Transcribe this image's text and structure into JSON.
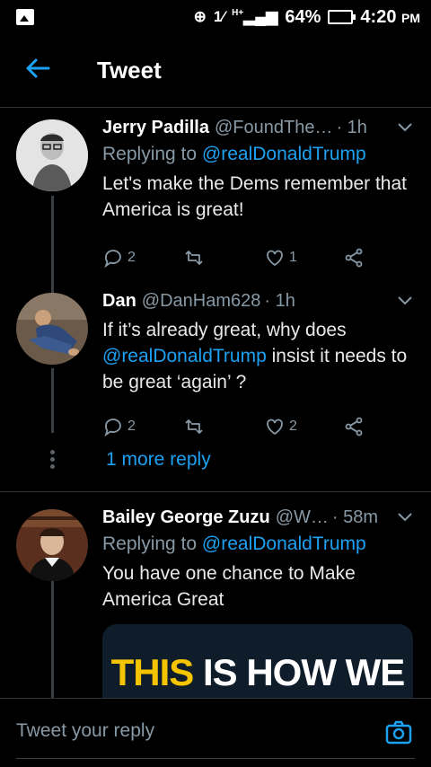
{
  "status_bar": {
    "signal_label": "1⁄",
    "network_label": "H+",
    "battery_text": "64%",
    "battery_level": 0.64,
    "time": "4:20",
    "ampm": "PM"
  },
  "header": {
    "title": "Tweet"
  },
  "tweets": [
    {
      "name": "Jerry Padilla",
      "handle": "@FoundThe…",
      "time": "· 1h",
      "replying_prefix": "Replying to",
      "replying_handle": "@realDonaldTrump",
      "text": "Let's make the Dems remember that America is great!",
      "replies": "2",
      "likes": "1"
    },
    {
      "name": "Dan",
      "handle": "@DanHam628",
      "time": "· 1h",
      "mention": "@realDonaldTrump",
      "text_after_mention": " insist it needs to be great ‘again’ ?",
      "text_before_mention": "If it’s already great, why does",
      "replies": "2",
      "likes": "2"
    },
    {
      "name": "Bailey George Zuzu",
      "handle": "@W…",
      "time": "· 58m",
      "replying_prefix": "Replying to",
      "replying_handle": "@realDonaldTrump",
      "text": "You have one chance to Make America Great",
      "media_text_yellow": "THIS",
      "media_text_white": "IS HOW WE"
    }
  ],
  "more_reply": "1 more reply",
  "reply_bar": {
    "placeholder": "Tweet your reply"
  },
  "colors": {
    "accent": "#1da1f2",
    "muted": "#8899a6",
    "background": "#000000"
  }
}
